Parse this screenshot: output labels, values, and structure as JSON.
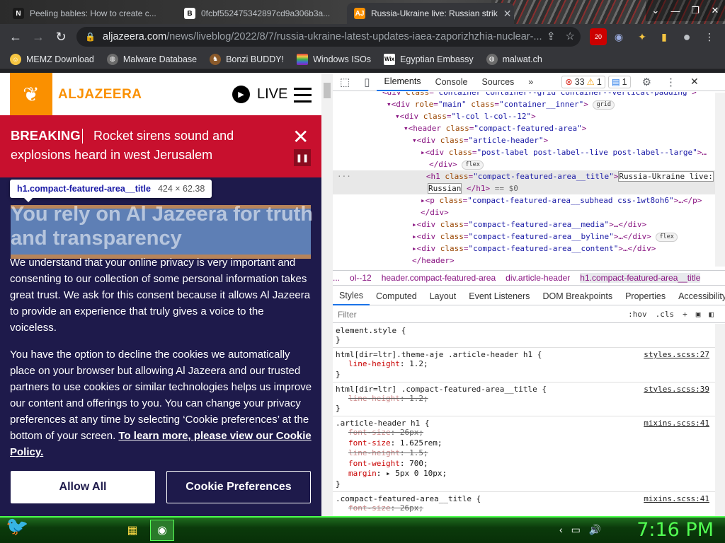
{
  "browser": {
    "tabs": [
      {
        "title": "Peeling bables: How to create c...",
        "favicon": "N"
      },
      {
        "title": "0fcbf552475342897cd9a306b3a...",
        "favicon": "B"
      },
      {
        "title": "Russia-Ukraine live: Russian strik",
        "favicon": "AJ"
      }
    ],
    "url_host": "aljazeera.com",
    "url_path": "/news/liveblog/2022/8/7/russia-ukraine-latest-updates-iaea-zaporizhzhia-nuclear-...",
    "ext_badge": "20",
    "bookmarks": [
      {
        "label": "MEMZ Download",
        "color": "#f5c542"
      },
      {
        "label": "Malware Database",
        "color": "#6b6b6b"
      },
      {
        "label": "Bonzi BUDDY!",
        "color": "#8a5a2b"
      },
      {
        "label": "Windows ISOs",
        "color": "#e03c3c"
      },
      {
        "label": "Egyptian Embassy",
        "color": "#ffffff"
      },
      {
        "label": "malwat.ch",
        "color": "#6b6b6b"
      }
    ]
  },
  "site": {
    "logo": "ALJAZEERA",
    "live_label": "LIVE",
    "breaking_label": "BREAKING",
    "breaking_text": "Rocket sirens sound and explosions heard in west Jerusalem",
    "tooltip_selector": "h1.compact-featured-area__title",
    "tooltip_dims": "424 × 62.38",
    "headline": "You rely on Al Jazeera for truth and transparency",
    "para1": "We understand that your online privacy is very important and consenting to our collection of some personal information takes great trust. We ask for this consent because it allows Al Jazeera to provide an experience that truly gives a voice to the voiceless.",
    "para2": "You have the option to decline the cookies we automatically place on your browser but allowing Al Jazeera and our trusted partners to use cookies or similar technologies helps us improve our content and offerings to you. You can change your privacy preferences at any time by selecting ‘Cookie preferences’ at the bottom of your screen.",
    "para2_link": "To learn more, please view our Cookie Policy.",
    "allow_btn": "Allow All",
    "prefs_btn": "Cookie Preferences"
  },
  "devtools": {
    "tabs": [
      "Elements",
      "Console",
      "Sources"
    ],
    "errors": "33",
    "warnings": "1",
    "messages": "1",
    "crumbs": [
      "...",
      "ol--12",
      "header.compact-featured-area",
      "div.article-header",
      "h1.compact-featured-area__title"
    ],
    "style_tabs": [
      "Styles",
      "Computed",
      "Layout",
      "Event Listeners",
      "DOM Breakpoints",
      "Properties",
      "Accessibility"
    ],
    "filter_placeholder": "Filter",
    "hov": ":hov",
    "cls": ".cls"
  },
  "taskbar": {
    "clock": "7:16 PM"
  }
}
